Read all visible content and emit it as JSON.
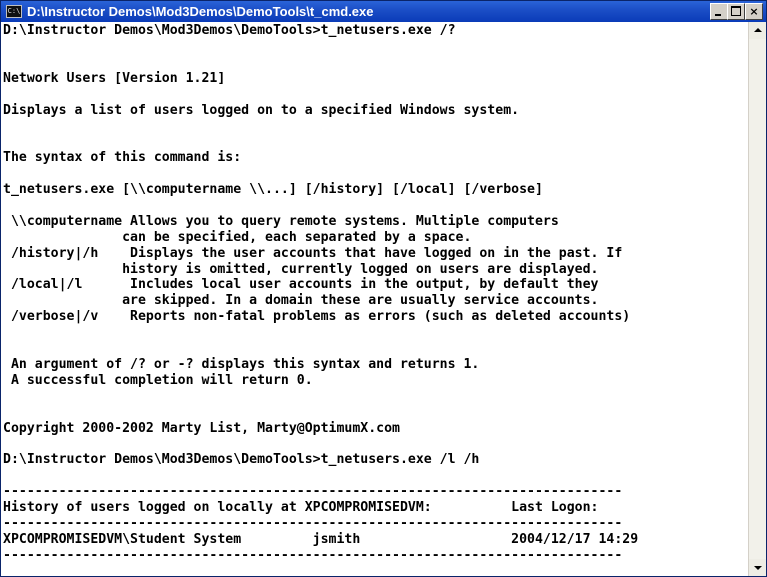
{
  "window": {
    "title": "D:\\Instructor Demos\\Mod3Demos\\DemoTools\\t_cmd.exe",
    "icon": "cmd-icon",
    "icon_text": "C:\\",
    "controls": {
      "minimize": "minimize-icon",
      "maximize": "maximize-icon",
      "close": "×"
    }
  },
  "console": {
    "lines": [
      "D:\\Instructor Demos\\Mod3Demos\\DemoTools>t_netusers.exe /?",
      "",
      "",
      "Network Users [Version 1.21]",
      "",
      "Displays a list of users logged on to a specified Windows system.",
      "",
      "",
      "The syntax of this command is:",
      "",
      "t_netusers.exe [\\\\computername \\\\...] [/history] [/local] [/verbose]",
      "",
      " \\\\computername Allows you to query remote systems. Multiple computers",
      "               can be specified, each separated by a space.",
      " /history|/h    Displays the user accounts that have logged on in the past. If",
      "               history is omitted, currently logged on users are displayed.",
      " /local|/l      Includes local user accounts in the output, by default they",
      "               are skipped. In a domain these are usually service accounts.",
      " /verbose|/v    Reports non-fatal problems as errors (such as deleted accounts)",
      "",
      "",
      " An argument of /? or -? displays this syntax and returns 1.",
      " A successful completion will return 0.",
      "",
      "",
      "Copyright 2000-2002 Marty List, Marty@OptimumX.com",
      "",
      "D:\\Instructor Demos\\Mod3Demos\\DemoTools>t_netusers.exe /l /h",
      "",
      "------------------------------------------------------------------------------",
      "History of users logged on locally at XPCOMPROMISEDVM:          Last Logon:",
      "------------------------------------------------------------------------------",
      "XPCOMPROMISEDVM\\Student System         jsmith                   2004/12/17 14:29",
      "------------------------------------------------------------------------------",
      ""
    ]
  },
  "scrollbar": {
    "up": "up-arrow-icon",
    "down": "down-arrow-icon"
  }
}
